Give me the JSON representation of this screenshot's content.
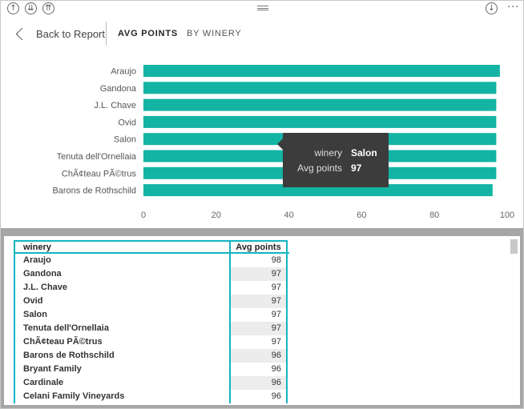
{
  "toolbar": {
    "icons": [
      "up-arrow-circle-icon",
      "down-double-arrow-circle-icon",
      "up-double-arrow-circle-icon",
      "download-circle-icon",
      "more-options-icon"
    ],
    "left_icon_glyphs": [
      "↑",
      "⇊",
      "⇈"
    ],
    "right_icon_glyph": "↓",
    "more_glyph": "···"
  },
  "nav": {
    "back_label": "Back to Report",
    "tab_active": "AVG POINTS",
    "tab_inactive": "BY WINERY"
  },
  "chart_data": {
    "type": "bar",
    "orientation": "horizontal",
    "categories": [
      "Araujo",
      "Gandona",
      "J.L. Chave",
      "Ovid",
      "Salon",
      "Tenuta dell'Ornellaia",
      "ChÃ¢teau PÃ©trus",
      "Barons de Rothschild"
    ],
    "values": [
      98,
      97,
      97,
      97,
      97,
      97,
      97,
      96
    ],
    "xlim": [
      0,
      100
    ],
    "x_ticks": [
      "0",
      "20",
      "40",
      "60",
      "80",
      "100"
    ],
    "bar_color": "#13b4a4",
    "grid": false,
    "legend": "none"
  },
  "tooltip": {
    "rows": [
      {
        "key": "winery",
        "value": "Salon"
      },
      {
        "key": "Avg points",
        "value": "97"
      }
    ]
  },
  "table": {
    "headers": [
      "winery",
      "Avg points"
    ],
    "rows": [
      {
        "winery": "Araujo",
        "avg": "98"
      },
      {
        "winery": "Gandona",
        "avg": "97"
      },
      {
        "winery": "J.L. Chave",
        "avg": "97"
      },
      {
        "winery": "Ovid",
        "avg": "97"
      },
      {
        "winery": "Salon",
        "avg": "97"
      },
      {
        "winery": "Tenuta dell'Ornellaia",
        "avg": "97"
      },
      {
        "winery": "ChÃ¢teau PÃ©trus",
        "avg": "97"
      },
      {
        "winery": "Barons de Rothschild",
        "avg": "96"
      },
      {
        "winery": "Bryant Family",
        "avg": "96"
      },
      {
        "winery": "Cardinale",
        "avg": "96"
      },
      {
        "winery": "Celani Family Vineyards",
        "avg": "96"
      }
    ]
  },
  "colors": {
    "accent": "#13b4a4",
    "table_border": "#13b4c4",
    "tooltip_bg": "#3c3c3c",
    "divider": "#a6a6a6"
  }
}
